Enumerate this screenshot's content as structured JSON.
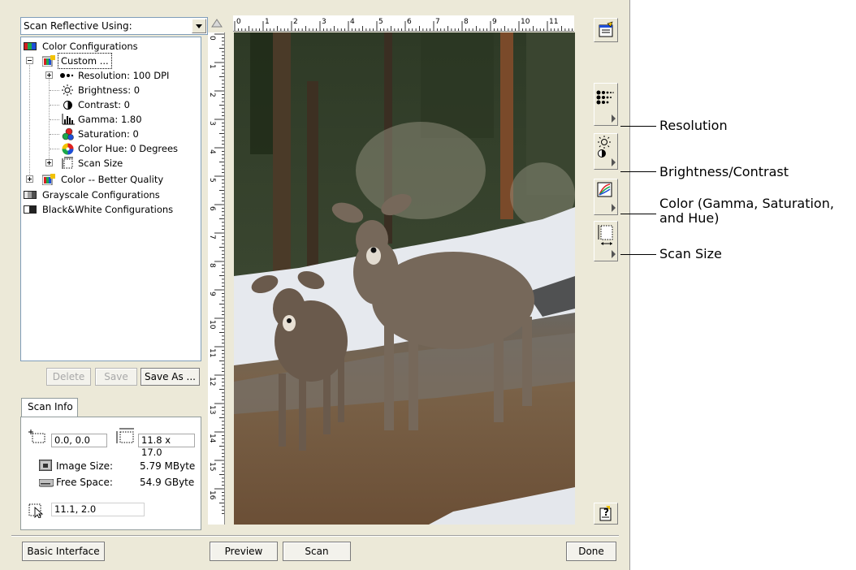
{
  "scan_source": {
    "label": "Scan Reflective Using:"
  },
  "tree": {
    "color_configurations": "Color Configurations",
    "custom": "Custom ...",
    "resolution": "Resolution: 100 DPI",
    "brightness": "Brightness: 0",
    "contrast": "Contrast: 0",
    "gamma": "Gamma: 1.80",
    "saturation": "Saturation: 0",
    "color_hue": "Color Hue: 0 Degrees",
    "scan_size": "Scan Size",
    "color_better": "Color -- Better Quality",
    "grayscale": "Grayscale Configurations",
    "bw": "Black&White Configurations"
  },
  "config_buttons": {
    "delete": "Delete",
    "save": "Save",
    "save_as": "Save As ..."
  },
  "scan_info": {
    "tab": "Scan Info",
    "origin": "0.0, 0.0",
    "dimensions": "11.8 x 17.0",
    "image_size_label": "Image Size:",
    "image_size_value": "5.79 MByte",
    "free_space_label": "Free Space:",
    "free_space_value": "54.9 GByte",
    "cursor": "11.1, 2.0"
  },
  "ruler": {
    "top": [
      "0",
      "1",
      "2",
      "3",
      "4",
      "5",
      "6",
      "7",
      "8",
      "9",
      "10",
      "11"
    ],
    "left": [
      "0",
      "1",
      "2",
      "3",
      "4",
      "5",
      "6",
      "7",
      "8",
      "9",
      "10",
      "11",
      "12",
      "13",
      "14",
      "15",
      "16"
    ]
  },
  "footer": {
    "basic_interface": "Basic Interface",
    "preview": "Preview",
    "scan": "Scan",
    "done": "Done"
  },
  "callouts": {
    "resolution": "Resolution",
    "brightness_contrast": "Brightness/Contrast",
    "color_line1": "Color (Gamma, Saturation,",
    "color_line2": "and Hue)",
    "scan_size": "Scan Size"
  },
  "icons": {
    "properties": "properties-icon",
    "resolution": "resolution-icon",
    "brightness": "brightness-icon",
    "color": "color-icon",
    "scan_size": "scan-size-icon",
    "help": "help-icon"
  }
}
